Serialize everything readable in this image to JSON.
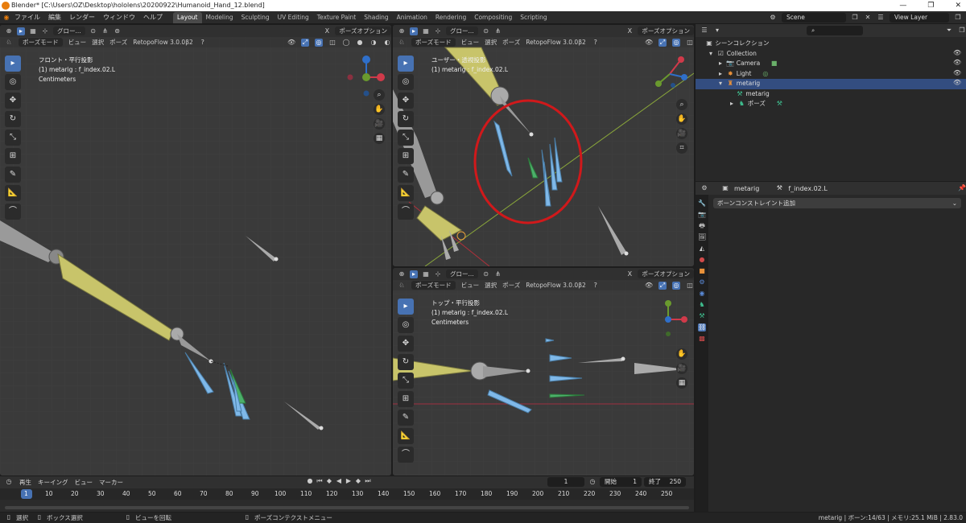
{
  "titlebar": {
    "title": "Blender* [C:\\Users\\OZ\\Desktop\\hololens\\20200922\\Humanoid_Hand_12.blend]",
    "controls": [
      "—",
      "❐",
      "✕"
    ]
  },
  "menubar": {
    "menus": [
      "ファイル",
      "編集",
      "レンダー",
      "ウィンドウ",
      "ヘルプ"
    ],
    "workspaces": [
      "Layout",
      "Modeling",
      "Sculpting",
      "UV Editing",
      "Texture Paint",
      "Shading",
      "Animation",
      "Rendering",
      "Compositing",
      "Scripting"
    ],
    "active_workspace": "Layout",
    "scene": "Scene",
    "view_layer": "View Layer"
  },
  "viewport_header": {
    "transform_orientation": "グロー...",
    "pose_options": "ポーズオプション",
    "mode": "ポーズモード",
    "menus": [
      "ビュー",
      "選択",
      "ポーズ"
    ],
    "addon": "RetopoFlow 3.0.0β2"
  },
  "viewports": {
    "left": {
      "view_name": "フロント・平行投影",
      "object_info": "(1) metarig : f_index.02.L",
      "units": "Centimeters"
    },
    "top_right": {
      "view_name": "ユーザー・透視投影",
      "object_info": "(1) metarig : f_index.02.L"
    },
    "bottom_right": {
      "view_name": "トップ・平行投影",
      "object_info": "(1) metarig : f_index.02.L",
      "units": "Centimeters"
    }
  },
  "outliner": {
    "search_placeholder": "",
    "items": [
      {
        "label": "シーンコレクション",
        "indent": 0
      },
      {
        "label": "Collection",
        "indent": 1
      },
      {
        "label": "Camera",
        "indent": 2
      },
      {
        "label": "Light",
        "indent": 2
      },
      {
        "label": "metarig",
        "indent": 2,
        "selected": true
      },
      {
        "label": "metarig",
        "indent": 3
      },
      {
        "label": "ポーズ",
        "indent": 3
      }
    ]
  },
  "properties": {
    "object": "metarig",
    "bone": "f_index.02.L",
    "add_constraint": "ボーンコンストレイント追加"
  },
  "timeline": {
    "menus": [
      "再生",
      "キーイング",
      "ビュー",
      "マーカー"
    ],
    "current_frame": "1",
    "start_label": "開始",
    "start": "1",
    "end_label": "終了",
    "end": "250",
    "ticks": [
      "1",
      "10",
      "20",
      "30",
      "40",
      "50",
      "60",
      "70",
      "80",
      "90",
      "100",
      "110",
      "120",
      "130",
      "140",
      "150",
      "160",
      "170",
      "180",
      "190",
      "200",
      "210",
      "220",
      "230",
      "240",
      "250"
    ]
  },
  "statusbar": {
    "select": "選択",
    "box_select": "ボックス選択",
    "rotate_view": "ビューを回転",
    "context_menu": "ポーズコンテクストメニュー",
    "stats": "metarig | ボーン:14/63 | メモリ:25.1 MiB | 2.83.0"
  },
  "colors": {
    "accent": "#4772b3",
    "highlight_circle": "#d0191b",
    "bone_yellow": "#b8b35a",
    "bone_blue": "#6fb0e0",
    "bone_green": "#3fa55a"
  }
}
